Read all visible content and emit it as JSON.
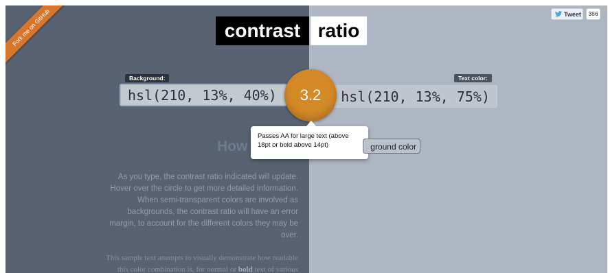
{
  "ribbon": {
    "text": "Fork me on GitHub"
  },
  "title": {
    "left": "contrast",
    "right": "ratio"
  },
  "tweet": {
    "label": "Tweet",
    "count": "386",
    "icon": "twitter-bird-icon"
  },
  "background_label": "Background:",
  "background_value": "hsl(210, 13%, 40%)",
  "text_color_label": "Text color:",
  "text_color_value": "hsl(210, 13%, 75%)",
  "ratio": "3.2",
  "tooltip": {
    "line1": "Passes AA for large text (above",
    "line2": "18pt or bold above 14pt)"
  },
  "swap_button": "ground color",
  "heading": "How",
  "info_text": "As you type, the contrast ratio indicated will update. Hover over the circle to get more detailed information. When semi-transparent colors are involved as backgrounds, the contrast ratio will have an error margin, to account for the different colors they may be over.",
  "sample": {
    "pre": "This sample text attempts to visually demonstrate how readable this color combination is, for normal or ",
    "bold": "bold",
    "post": " text of various"
  },
  "colors": {
    "background": "#586270",
    "text_color": "#aeb6c1",
    "accent": "#d58a28"
  }
}
